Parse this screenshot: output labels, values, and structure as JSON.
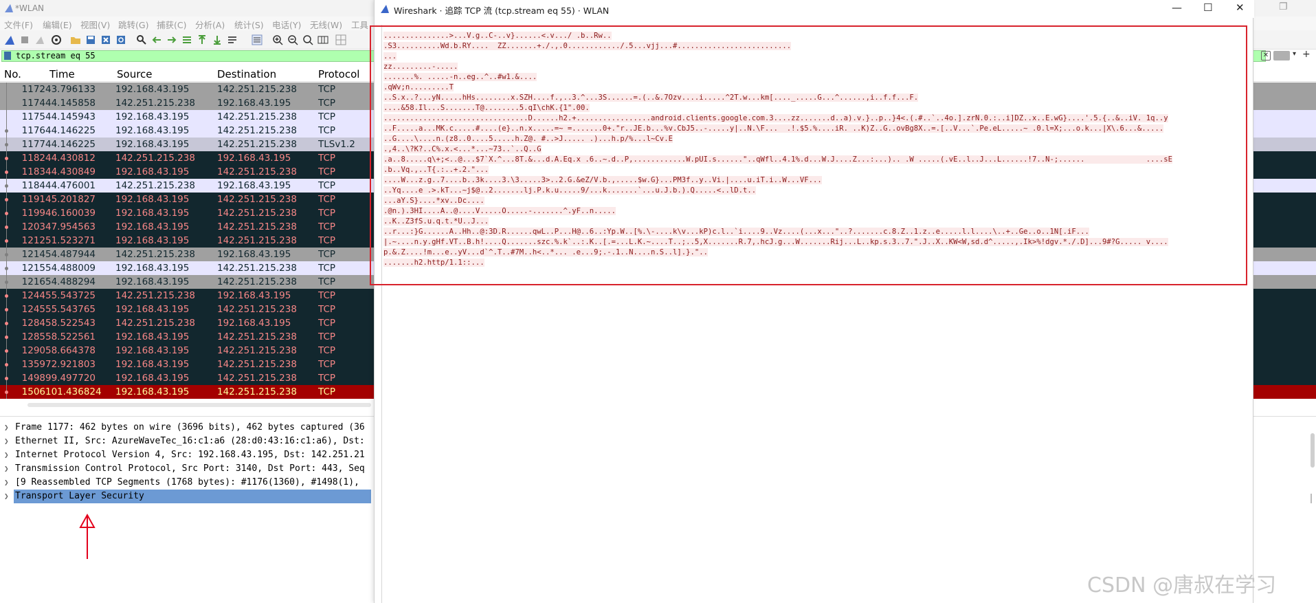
{
  "main_window": {
    "title": "*WLAN",
    "menu": [
      "文件(F)",
      "编辑(E)",
      "视图(V)",
      "跳转(G)",
      "捕获(C)",
      "分析(A)",
      "统计(S)",
      "电话(Y)",
      "无线(W)",
      "工具"
    ],
    "filter": "tcp.stream eq 55",
    "columns": [
      "No.",
      "Time",
      "Source",
      "Destination",
      "Protocol"
    ],
    "packets": [
      {
        "no": "1172",
        "time": "43.796133",
        "src": "192.168.43.195",
        "dst": "142.251.215.238",
        "proto": "TCP"
      },
      {
        "no": "1174",
        "time": "44.145858",
        "src": "142.251.215.238",
        "dst": "192.168.43.195",
        "proto": "TCP"
      },
      {
        "no": "1175",
        "time": "44.145943",
        "src": "192.168.43.195",
        "dst": "142.251.215.238",
        "proto": "TCP"
      },
      {
        "no": "1176",
        "time": "44.146225",
        "src": "192.168.43.195",
        "dst": "142.251.215.238",
        "proto": "TCP"
      },
      {
        "no": "1177",
        "time": "44.146225",
        "src": "192.168.43.195",
        "dst": "142.251.215.238",
        "proto": "TLSv1.2"
      },
      {
        "no": "1182",
        "time": "44.430812",
        "src": "142.251.215.238",
        "dst": "192.168.43.195",
        "proto": "TCP"
      },
      {
        "no": "1183",
        "time": "44.430849",
        "src": "192.168.43.195",
        "dst": "142.251.215.238",
        "proto": "TCP"
      },
      {
        "no": "1184",
        "time": "44.476001",
        "src": "142.251.215.238",
        "dst": "192.168.43.195",
        "proto": "TCP"
      },
      {
        "no": "1191",
        "time": "45.201827",
        "src": "192.168.43.195",
        "dst": "142.251.215.238",
        "proto": "TCP"
      },
      {
        "no": "1199",
        "time": "46.160039",
        "src": "192.168.43.195",
        "dst": "142.251.215.238",
        "proto": "TCP"
      },
      {
        "no": "1203",
        "time": "47.954563",
        "src": "192.168.43.195",
        "dst": "142.251.215.238",
        "proto": "TCP"
      },
      {
        "no": "1212",
        "time": "51.523271",
        "src": "192.168.43.195",
        "dst": "142.251.215.238",
        "proto": "TCP"
      },
      {
        "no": "1214",
        "time": "54.487944",
        "src": "142.251.215.238",
        "dst": "192.168.43.195",
        "proto": "TCP"
      },
      {
        "no": "1215",
        "time": "54.488009",
        "src": "192.168.43.195",
        "dst": "142.251.215.238",
        "proto": "TCP"
      },
      {
        "no": "1216",
        "time": "54.488294",
        "src": "192.168.43.195",
        "dst": "142.251.215.238",
        "proto": "TCP"
      },
      {
        "no": "1244",
        "time": "55.543725",
        "src": "142.251.215.238",
        "dst": "192.168.43.195",
        "proto": "TCP"
      },
      {
        "no": "1245",
        "time": "55.543765",
        "src": "192.168.43.195",
        "dst": "142.251.215.238",
        "proto": "TCP"
      },
      {
        "no": "1284",
        "time": "58.522543",
        "src": "142.251.215.238",
        "dst": "192.168.43.195",
        "proto": "TCP"
      },
      {
        "no": "1285",
        "time": "58.522561",
        "src": "192.168.43.195",
        "dst": "142.251.215.238",
        "proto": "TCP"
      },
      {
        "no": "1290",
        "time": "58.664378",
        "src": "192.168.43.195",
        "dst": "142.251.215.238",
        "proto": "TCP"
      },
      {
        "no": "1359",
        "time": "72.921803",
        "src": "192.168.43.195",
        "dst": "142.251.215.238",
        "proto": "TCP"
      },
      {
        "no": "1498",
        "time": "99.497720",
        "src": "192.168.43.195",
        "dst": "142.251.215.238",
        "proto": "TCP"
      },
      {
        "no": "1506",
        "time": "101.436824",
        "src": "192.168.43.195",
        "dst": "142.251.215.238",
        "proto": "TCP"
      }
    ],
    "details": [
      "Frame 1177: 462 bytes on wire (3696 bits), 462 bytes captured (36",
      "Ethernet II, Src: AzureWaveTec_16:c1:a6 (28:d0:43:16:c1:a6), Dst:",
      "Internet Protocol Version 4, Src: 192.168.43.195, Dst: 142.251.21",
      "Transmission Control Protocol, Src Port: 3140, Dst Port: 443, Seq",
      "[9 Reassembled TCP Segments (1768 bytes): #1176(1360), #1498(1),",
      "Transport Layer Security"
    ]
  },
  "follow_dialog": {
    "title": "Wireshark · 追踪 TCP 流 (tcp.stream eq 55) · WLAN",
    "stream_lines": [
      "...............>...V.g..C-..v}......<.v.../ .b..Rw..",
      ".S3..........Wd.b.RY....  ZZ.......+./.,.0............/.5...vjj...#..........................",
      "...",
      "zz.........-.....",
      ".......%. .....-n..eg..^..#w1.&....",
      ".qWv;n.........T",
      "..S.x..?...yN.....hHs........x.SZH....f.,..3.^...3S......=.(..&.7Ozv....i.....^2T.w...km[...._.....G...^......,i..f.f...F.",
      "....&58.Il...S.......T@........5.qI\\chK.{1\".00.",
      ".................................D......h2.+.................android.clients.google.com.3....zz.......d..a).v.}..p..}4<.(.#..`..4o.].zrN.0.:..i]DZ..x..E.wG}....'.5.{..&..iV. 1q..y",
      "..F.....a...MK.c.....#....(e}..n.x.....=~ =.......0+.\"r..JE.b...%v.CbJ5..-.....y|..N.\\F...  .!.$5.%....iR. ..K)Z..G..ovBg8X..=.[..V...`.Pe.eL.....~ .0.l=X;...o.k...|X\\.6...&.....",
      "..G....\\....n.(z8..0....5.....h.Z@. #..>J..... .)...h.p/%...l~Cv.E",
      ".,4..\\?K?..C%.x.<...*...~73..`..Q..G",
      ".a..8.....q\\+;<..@...$7`X.^...8T.&...d.A.Eq.x .6..~.d..P,............W.pUI.s......\"..qWfl..4.1%.d...W.J....Z...:...).. .W .....(.vE..l..J...L......!7..N-;......              ....sE",
      ".b..Vq.,..T{.:..+.2.\"...",
      "....W...z.g..7....b..3k....3.\\3.....3>..2.G.&eZ/V.b.,.....$w.G}...PM3f..y..Vi.|....u.iT.i..W...VF...",
      "..Yq....e .>.kT...~j$@..2.......lj.P.k.u.....9/...k.......`...u.J.b.).Q.....<..lD.t..",
      "...aY.S}....*xv..Dc....",
      ".@n.).3HI....A..@....V.....O.....-.......^.yF..n.....",
      "..K..Z3fS.u.q.t.*U..J...",
      "..r...:}G......A..Hh..@:3D.R......qwL..P...H@..6..:Yp.W..[%.\\-....k\\v...kP)c.l..`i....9..Vz....(...x...\"..?.......c.8.Z..1.z..e.....l.l....\\..+..Ge..o..1N[.iF...",
      "|.~....n.y.gHf.VT..B.h!....Q.......szc.%.k`..:.K..[.=...L.K.~....T..;..5,X.......R.7,.hcJ.g...W.......Rij...L..kp.s.3..7.\".J..X..KW<W,sd.d^.....,.Ik>%!dgv.*./.D]...9#?G..... v....",
      "p.&.Z....!m...e..yV...d`^.T..#7M..h<..*... .e...9;.-.1..N....n.S..l].}.\"..",
      ".......h2.http/1.1::..."
    ]
  },
  "watermark": "CSDN @唐叔在学习",
  "colors": {
    "dark_row": "#12272e",
    "dark_row_text": "#f78787",
    "gray_row": "#a0a0a0",
    "lavender_row": "#e7e6ff",
    "tls_row": "#c7c7d7",
    "marked_row": "#a40000",
    "marked_row_text": "#fffc9c",
    "filter_bg": "#afffaf",
    "stream_text": "#8b1a1a",
    "stream_bg": "#fbeaea",
    "highlight_box": "#d8222c"
  }
}
